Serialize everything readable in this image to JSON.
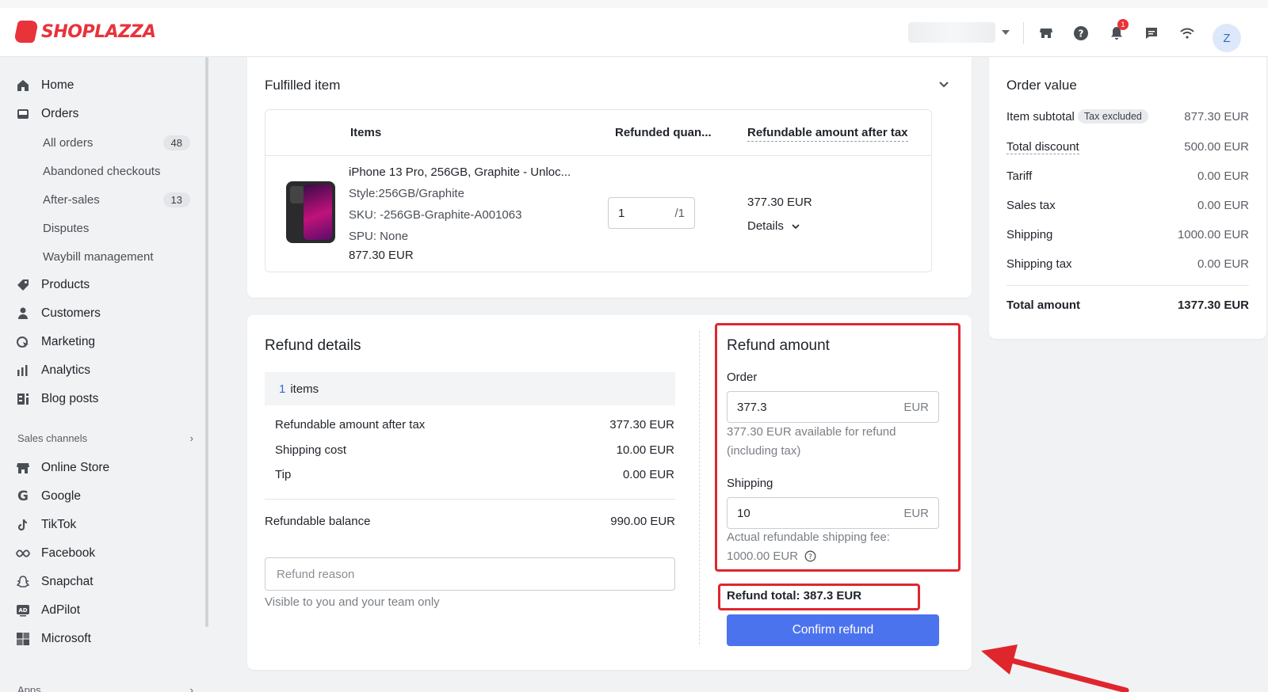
{
  "brand": {
    "name": "SHOPLAZZA",
    "color": "#e8333b"
  },
  "header": {
    "notification_count": "1",
    "avatar_letter": "Z",
    "icons": [
      "store-icon",
      "help-icon",
      "bell-icon",
      "chat-icon",
      "wifi-icon"
    ]
  },
  "sidebar": {
    "items": [
      {
        "label": "Home",
        "icon": "home-icon"
      },
      {
        "label": "Orders",
        "icon": "inbox-icon"
      }
    ],
    "orders_sub": [
      {
        "label": "All orders",
        "count": "48"
      },
      {
        "label": "Abandoned checkouts"
      },
      {
        "label": "After-sales",
        "count": "13"
      },
      {
        "label": "Disputes"
      },
      {
        "label": "Waybill management"
      }
    ],
    "items2": [
      {
        "label": "Products",
        "icon": "tag-icon"
      },
      {
        "label": "Customers",
        "icon": "person-icon"
      },
      {
        "label": "Marketing",
        "icon": "marketing-icon"
      },
      {
        "label": "Analytics",
        "icon": "bar-chart-icon"
      },
      {
        "label": "Blog posts",
        "icon": "blog-icon"
      }
    ],
    "sales_channels_label": "Sales channels",
    "channels": [
      {
        "label": "Online Store",
        "icon": "store-icon"
      },
      {
        "label": "Google",
        "icon": "google-icon"
      },
      {
        "label": "TikTok",
        "icon": "tiktok-icon"
      },
      {
        "label": "Facebook",
        "icon": "facebook-icon"
      },
      {
        "label": "Snapchat",
        "icon": "snapchat-icon"
      },
      {
        "label": "AdPilot",
        "icon": "adpilot-icon"
      },
      {
        "label": "Microsoft",
        "icon": "microsoft-icon"
      }
    ],
    "apps_label": "Apps"
  },
  "fulfilled": {
    "title": "Fulfilled item",
    "columns": [
      "Items",
      "Refunded quan...",
      "Refundable amount after tax"
    ],
    "product": {
      "name": "iPhone 13 Pro, 256GB, Graphite - Unloc...",
      "style": "Style:256GB/Graphite",
      "sku": "SKU: -256GB-Graphite-A001063",
      "spu": "SPU: None",
      "price": "877.30 EUR",
      "qty": "1",
      "qty_of": "/1",
      "refundable": "377.30 EUR",
      "details": "Details"
    }
  },
  "refund_details": {
    "title": "Refund details",
    "items_count": "1",
    "items_label": "items",
    "rows": [
      {
        "label": "Refundable amount after tax",
        "value": "377.30 EUR"
      },
      {
        "label": "Shipping cost",
        "value": "10.00 EUR"
      },
      {
        "label": "Tip",
        "value": "0.00 EUR"
      }
    ],
    "balance_label": "Refundable balance",
    "balance_value": "990.00 EUR",
    "reason_placeholder": "Refund reason",
    "reason_hint": "Visible to you and your team only"
  },
  "refund_amount": {
    "title": "Refund amount",
    "order_label": "Order",
    "order_value": "377.3",
    "currency": "EUR",
    "order_hint_1": "377.30 EUR available for refund",
    "order_hint_2": "(including tax)",
    "shipping_label": "Shipping",
    "shipping_value": "10",
    "shipping_hint_1": "Actual refundable shipping fee:",
    "shipping_hint_2": "1000.00 EUR",
    "total": "Refund total: 387.3 EUR",
    "confirm_label": "Confirm refund",
    "highlight_color": "#e0262d",
    "button_color": "#4c73ee"
  },
  "order_value": {
    "title": "Order value",
    "subtotal_label": "Item subtotal",
    "tax_pill": "Tax excluded",
    "subtotal_value": "877.30 EUR",
    "rows": [
      {
        "label": "Total discount",
        "value": "500.00 EUR"
      },
      {
        "label": "Tariff",
        "value": "0.00 EUR"
      },
      {
        "label": "Sales tax",
        "value": "0.00 EUR"
      },
      {
        "label": "Shipping",
        "value": "1000.00 EUR"
      },
      {
        "label": "Shipping tax",
        "value": "0.00 EUR"
      }
    ],
    "total_label": "Total amount",
    "total_value": "1377.30 EUR"
  }
}
